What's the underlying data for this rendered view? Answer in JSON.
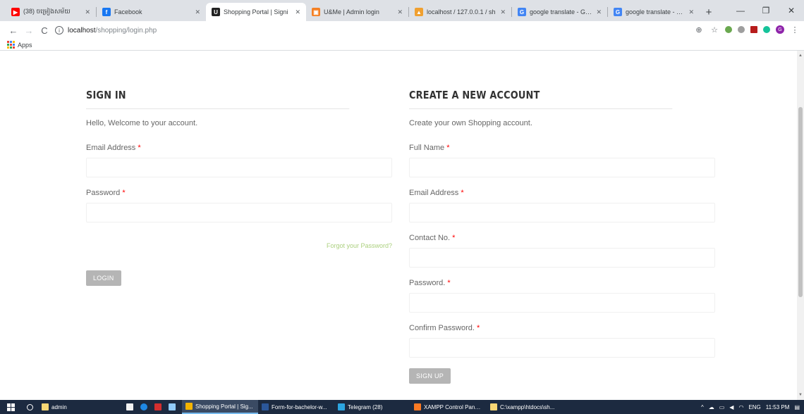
{
  "browser": {
    "tabs": [
      {
        "title": "(38) ចម្រៀងសម័យ",
        "icon": "youtube-icon",
        "color": "#ff0000",
        "glyph": "▶"
      },
      {
        "title": "Facebook",
        "icon": "facebook-icon",
        "color": "#1877f2",
        "glyph": "f"
      },
      {
        "title": "Shopping Portal | Signi",
        "icon": "shopping-portal-icon",
        "color": "#222222",
        "glyph": "U",
        "active": true
      },
      {
        "title": "U&Me | Admin login",
        "icon": "admin-login-icon",
        "color": "#f48024",
        "glyph": "▣"
      },
      {
        "title": "localhost / 127.0.0.1 / sh",
        "icon": "phpmyadmin-icon",
        "color": "#f0a030",
        "glyph": "▲"
      },
      {
        "title": "google translate - Goo",
        "icon": "google-icon",
        "color": "#4285f4",
        "glyph": "G"
      },
      {
        "title": "google translate - Goo",
        "icon": "google-icon",
        "color": "#4285f4",
        "glyph": "G"
      }
    ],
    "new_tab": "+",
    "url_host": "localhost",
    "url_path": "/shopping/login.php",
    "bookmarks_apps": "Apps"
  },
  "signin": {
    "title": "SIGN IN",
    "subtitle": "Hello, Welcome to your account.",
    "email_label": "Email Address",
    "password_label": "Password",
    "forgot": "Forgot your Password?",
    "login_button": "LOGIN",
    "required_mark": "*"
  },
  "register": {
    "title": "CREATE A NEW ACCOUNT",
    "subtitle": "Create your own Shopping account.",
    "fullname_label": "Full Name",
    "email_label": "Email Address",
    "contact_label": "Contact No.",
    "password_label": "Password.",
    "confirm_label": "Confirm Password.",
    "signup_button": "SIGN UP",
    "required_mark": "*"
  },
  "taskbar": {
    "search_text": "admin",
    "apps": [
      {
        "label": "Shopping Portal | Sig...",
        "icon": "chrome-icon",
        "color": "#f4b400",
        "active": true
      },
      {
        "label": "Form-for-bachelor-w...",
        "icon": "word-icon",
        "color": "#2b579a"
      },
      {
        "label": "Telegram (28)",
        "icon": "telegram-icon",
        "color": "#2ca5e0"
      },
      {
        "label": "XAMPP Control Panel...",
        "icon": "xampp-icon",
        "color": "#fb7a24"
      },
      {
        "label": "C:\\xampp\\htdocs\\sh...",
        "icon": "folder-icon",
        "color": "#f8d775"
      }
    ],
    "lang": "ENG",
    "time": "11:53 PM"
  }
}
